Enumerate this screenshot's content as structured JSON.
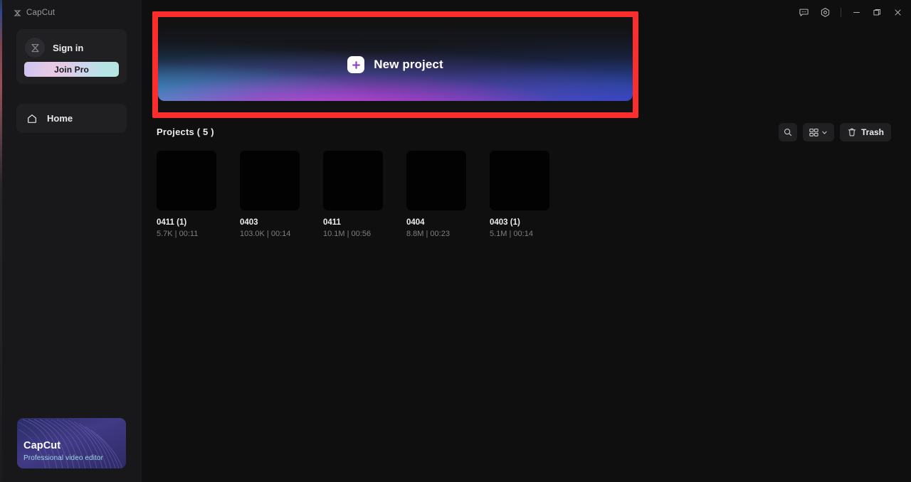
{
  "app": {
    "brand": "CapCut",
    "brand_mark_icon": "capcut-logo-icon"
  },
  "sidebar": {
    "account": {
      "avatar_icon": "capcut-avatar-icon",
      "signin_label": "Sign in",
      "join_pro_label": "Join Pro"
    },
    "nav": [
      {
        "label": "Home",
        "icon": "home-icon"
      }
    ],
    "promo": {
      "title": "CapCut",
      "subtitle": "Professional video editor"
    }
  },
  "titlebar": {
    "buttons": [
      {
        "name": "feedback-icon",
        "label": "Feedback"
      },
      {
        "name": "settings-gear-icon",
        "label": "Settings"
      }
    ],
    "window_controls": [
      {
        "name": "minimize-icon",
        "label": "Minimize"
      },
      {
        "name": "maximize-icon",
        "label": "Maximize"
      },
      {
        "name": "close-icon",
        "label": "Close"
      }
    ]
  },
  "main": {
    "banner": {
      "label": "New project",
      "plus_icon": "plus-icon",
      "highlight_color": "#fc2d2d"
    },
    "projects_header": {
      "title": "Projects ( 5 )",
      "count": 5,
      "search_icon": "search-icon",
      "view_mode_icon": "grid-view-icon",
      "view_mode_chevron": "chevron-down-icon",
      "trash_icon": "trash-icon",
      "trash_label": "Trash"
    },
    "projects": [
      {
        "name": "0411 (1)",
        "meta": "5.7K | 00:11",
        "size": "5.7K",
        "duration": "00:11"
      },
      {
        "name": "0403",
        "meta": "103.0K | 00:14",
        "size": "103.0K",
        "duration": "00:14"
      },
      {
        "name": "0411",
        "meta": "10.1M | 00:56",
        "size": "10.1M",
        "duration": "00:56"
      },
      {
        "name": "0404",
        "meta": "8.8M | 00:23",
        "size": "8.8M",
        "duration": "00:23"
      },
      {
        "name": "0403 (1)",
        "meta": "5.1M | 00:14",
        "size": "5.1M",
        "duration": "00:14"
      }
    ]
  },
  "colors": {
    "sidebar_bg": "#18181a",
    "main_bg": "#0f0f10",
    "card_bg": "#202023",
    "accent_red": "#fc2d2d",
    "text_primary": "#ededf0",
    "text_muted": "#7e7e84"
  }
}
